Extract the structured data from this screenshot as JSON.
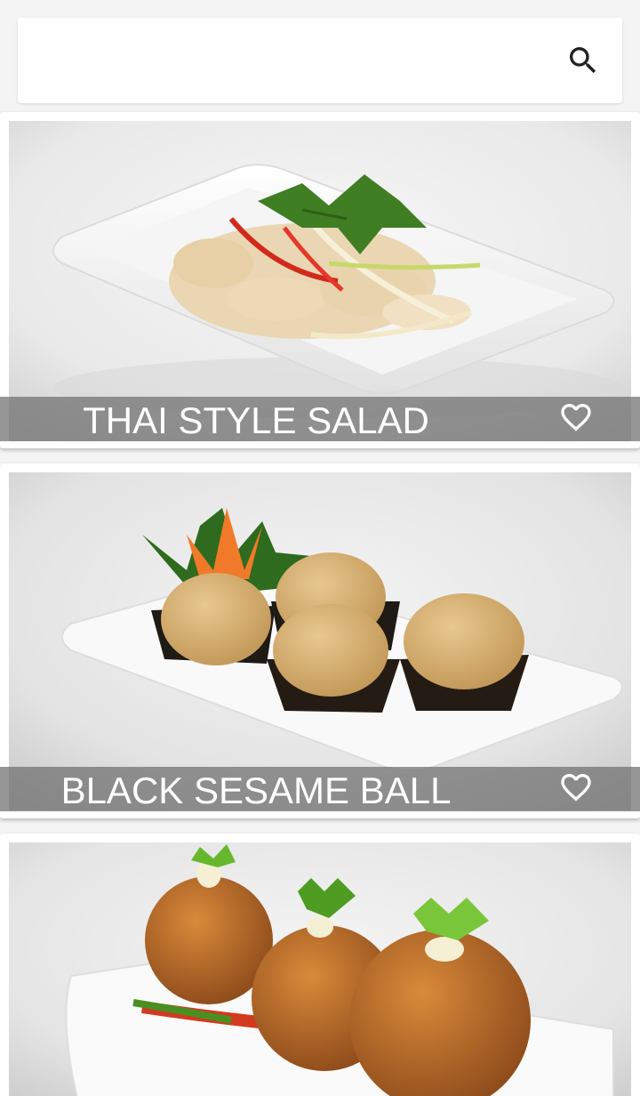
{
  "search": {
    "value": "",
    "icon": "search-icon"
  },
  "menu_items": [
    {
      "name": "THAI STYLE SALAD",
      "favorite": false,
      "favorite_icon": "heart-outline-icon"
    },
    {
      "name": "BLACK SESAME BALL",
      "favorite": false,
      "favorite_icon": "heart-outline-icon"
    },
    {
      "name": "",
      "favorite": false,
      "favorite_icon": "heart-outline-icon"
    }
  ],
  "colors": {
    "background": "#f4f4f4",
    "card": "#ffffff",
    "caption_overlay": "#6e6e6e",
    "caption_text": "#ffffff",
    "icon": "#212121"
  }
}
